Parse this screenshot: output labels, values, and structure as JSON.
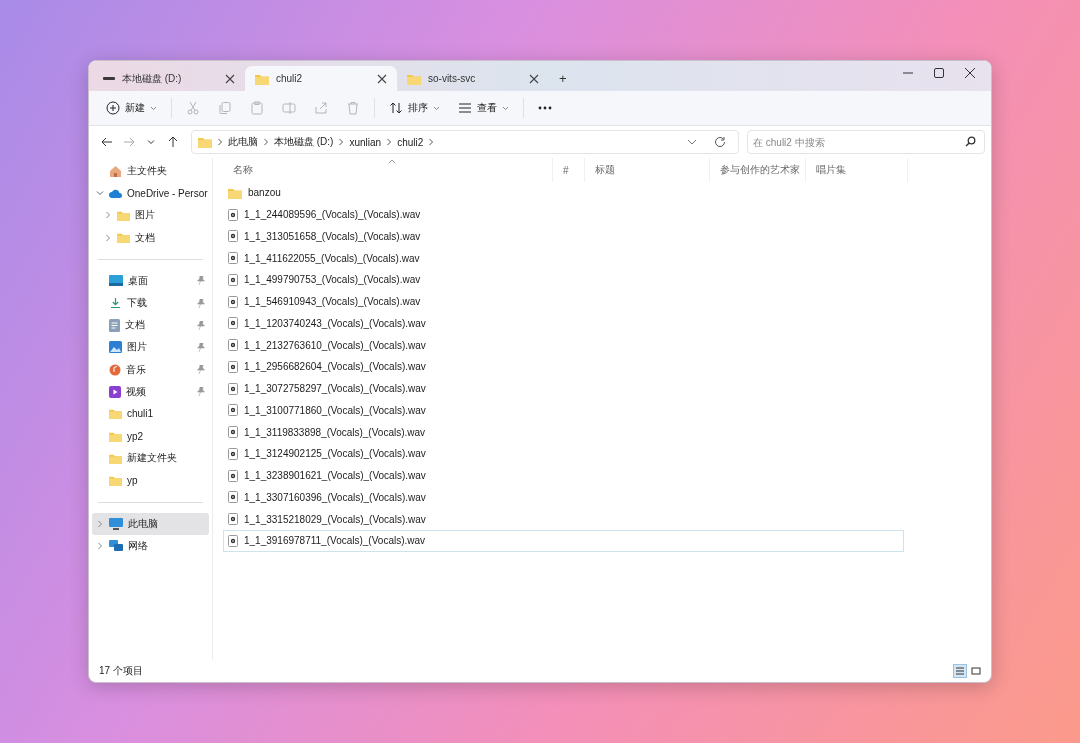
{
  "tabs": [
    {
      "kind": "drive",
      "label": "本地磁盘 (D:)",
      "selected": false
    },
    {
      "kind": "folder",
      "label": "chuli2",
      "selected": true
    },
    {
      "kind": "folder",
      "label": "so-vits-svc",
      "selected": false
    }
  ],
  "new_tab": "+",
  "toolbar": [
    {
      "kind": "new",
      "label": "新建",
      "dropdown": true,
      "disabled": false
    },
    {
      "kind": "cut",
      "disabled": true
    },
    {
      "kind": "copy",
      "disabled": true
    },
    {
      "kind": "paste",
      "disabled": true
    },
    {
      "kind": "rename",
      "disabled": true
    },
    {
      "kind": "share",
      "disabled": true
    },
    {
      "kind": "delete",
      "disabled": true
    },
    {
      "kind": "sort",
      "label": "排序",
      "dropdown": true,
      "disabled": false
    },
    {
      "kind": "view",
      "label": "查看",
      "dropdown": true,
      "disabled": false
    },
    {
      "kind": "more",
      "disabled": false
    }
  ],
  "nav": [
    {
      "kind": "back",
      "disabled": false
    },
    {
      "kind": "forward",
      "disabled": true
    },
    {
      "kind": "recent",
      "disabled": false
    },
    {
      "kind": "up",
      "disabled": false
    }
  ],
  "breadcrumbs": [
    "此电脑",
    "本地磁盘 (D:)",
    "xunlian",
    "chuli2"
  ],
  "search": {
    "placeholder": "在 chuli2 中搜索"
  },
  "sidebar": {
    "groups": [
      {
        "items": [
          {
            "kind": "home",
            "label": "主文件夹",
            "selected": false
          },
          {
            "kind": "cloud",
            "label": "OneDrive - Persor",
            "selected": false,
            "expanded": true,
            "children": [
              {
                "kind": "folder",
                "label": "图片",
                "selected": false,
                "expanded": false
              },
              {
                "kind": "folder",
                "label": "文档",
                "selected": false,
                "expanded": false
              }
            ]
          }
        ]
      },
      {
        "items": [
          {
            "kind": "desktop",
            "label": "桌面",
            "selected": false,
            "pinned": true
          },
          {
            "kind": "download",
            "label": "下载",
            "selected": false,
            "pinned": true
          },
          {
            "kind": "docs",
            "label": "文档",
            "selected": false,
            "pinned": true
          },
          {
            "kind": "pictures",
            "label": "图片",
            "selected": false,
            "pinned": true
          },
          {
            "kind": "music",
            "label": "音乐",
            "selected": false,
            "pinned": true
          },
          {
            "kind": "video",
            "label": "视频",
            "selected": false,
            "pinned": true
          },
          {
            "kind": "folder",
            "label": "chuli1",
            "selected": false,
            "pinned": false
          },
          {
            "kind": "folder",
            "label": "yp2",
            "selected": false,
            "pinned": false
          },
          {
            "kind": "folder",
            "label": "新建文件夹",
            "selected": false,
            "pinned": false
          },
          {
            "kind": "folder",
            "label": "yp",
            "selected": false,
            "pinned": false
          }
        ]
      },
      {
        "items": [
          {
            "kind": "pc",
            "label": "此电脑",
            "selected": true,
            "expanded": false
          },
          {
            "kind": "network",
            "label": "网络",
            "selected": false,
            "expanded": false
          }
        ]
      }
    ]
  },
  "columns": [
    {
      "label": "名称",
      "sorted": true
    },
    {
      "label": "#",
      "sorted": false
    },
    {
      "label": "标题",
      "sorted": false
    },
    {
      "label": "参与创作的艺术家",
      "sorted": false
    },
    {
      "label": "唱片集",
      "sorted": false
    }
  ],
  "files": [
    {
      "kind": "folder",
      "name": "banzou",
      "selected": false
    },
    {
      "kind": "audio",
      "name": "1_1_244089596_(Vocals)_(Vocals).wav",
      "selected": false
    },
    {
      "kind": "audio",
      "name": "1_1_313051658_(Vocals)_(Vocals).wav",
      "selected": false
    },
    {
      "kind": "audio",
      "name": "1_1_411622055_(Vocals)_(Vocals).wav",
      "selected": false
    },
    {
      "kind": "audio",
      "name": "1_1_499790753_(Vocals)_(Vocals).wav",
      "selected": false
    },
    {
      "kind": "audio",
      "name": "1_1_546910943_(Vocals)_(Vocals).wav",
      "selected": false
    },
    {
      "kind": "audio",
      "name": "1_1_1203740243_(Vocals)_(Vocals).wav",
      "selected": false
    },
    {
      "kind": "audio",
      "name": "1_1_2132763610_(Vocals)_(Vocals).wav",
      "selected": false
    },
    {
      "kind": "audio",
      "name": "1_1_2956682604_(Vocals)_(Vocals).wav",
      "selected": false
    },
    {
      "kind": "audio",
      "name": "1_1_3072758297_(Vocals)_(Vocals).wav",
      "selected": false
    },
    {
      "kind": "audio",
      "name": "1_1_3100771860_(Vocals)_(Vocals).wav",
      "selected": false
    },
    {
      "kind": "audio",
      "name": "1_1_3119833898_(Vocals)_(Vocals).wav",
      "selected": false
    },
    {
      "kind": "audio",
      "name": "1_1_3124902125_(Vocals)_(Vocals).wav",
      "selected": false
    },
    {
      "kind": "audio",
      "name": "1_1_3238901621_(Vocals)_(Vocals).wav",
      "selected": false
    },
    {
      "kind": "audio",
      "name": "1_1_3307160396_(Vocals)_(Vocals).wav",
      "selected": false
    },
    {
      "kind": "audio",
      "name": "1_1_3315218029_(Vocals)_(Vocals).wav",
      "selected": false
    },
    {
      "kind": "audio",
      "name": "1_1_3916978711_(Vocals)_(Vocals).wav",
      "selected": true
    }
  ],
  "status": "17 个项目",
  "views": [
    {
      "kind": "details",
      "selected": true
    },
    {
      "kind": "tiles",
      "selected": false
    }
  ]
}
